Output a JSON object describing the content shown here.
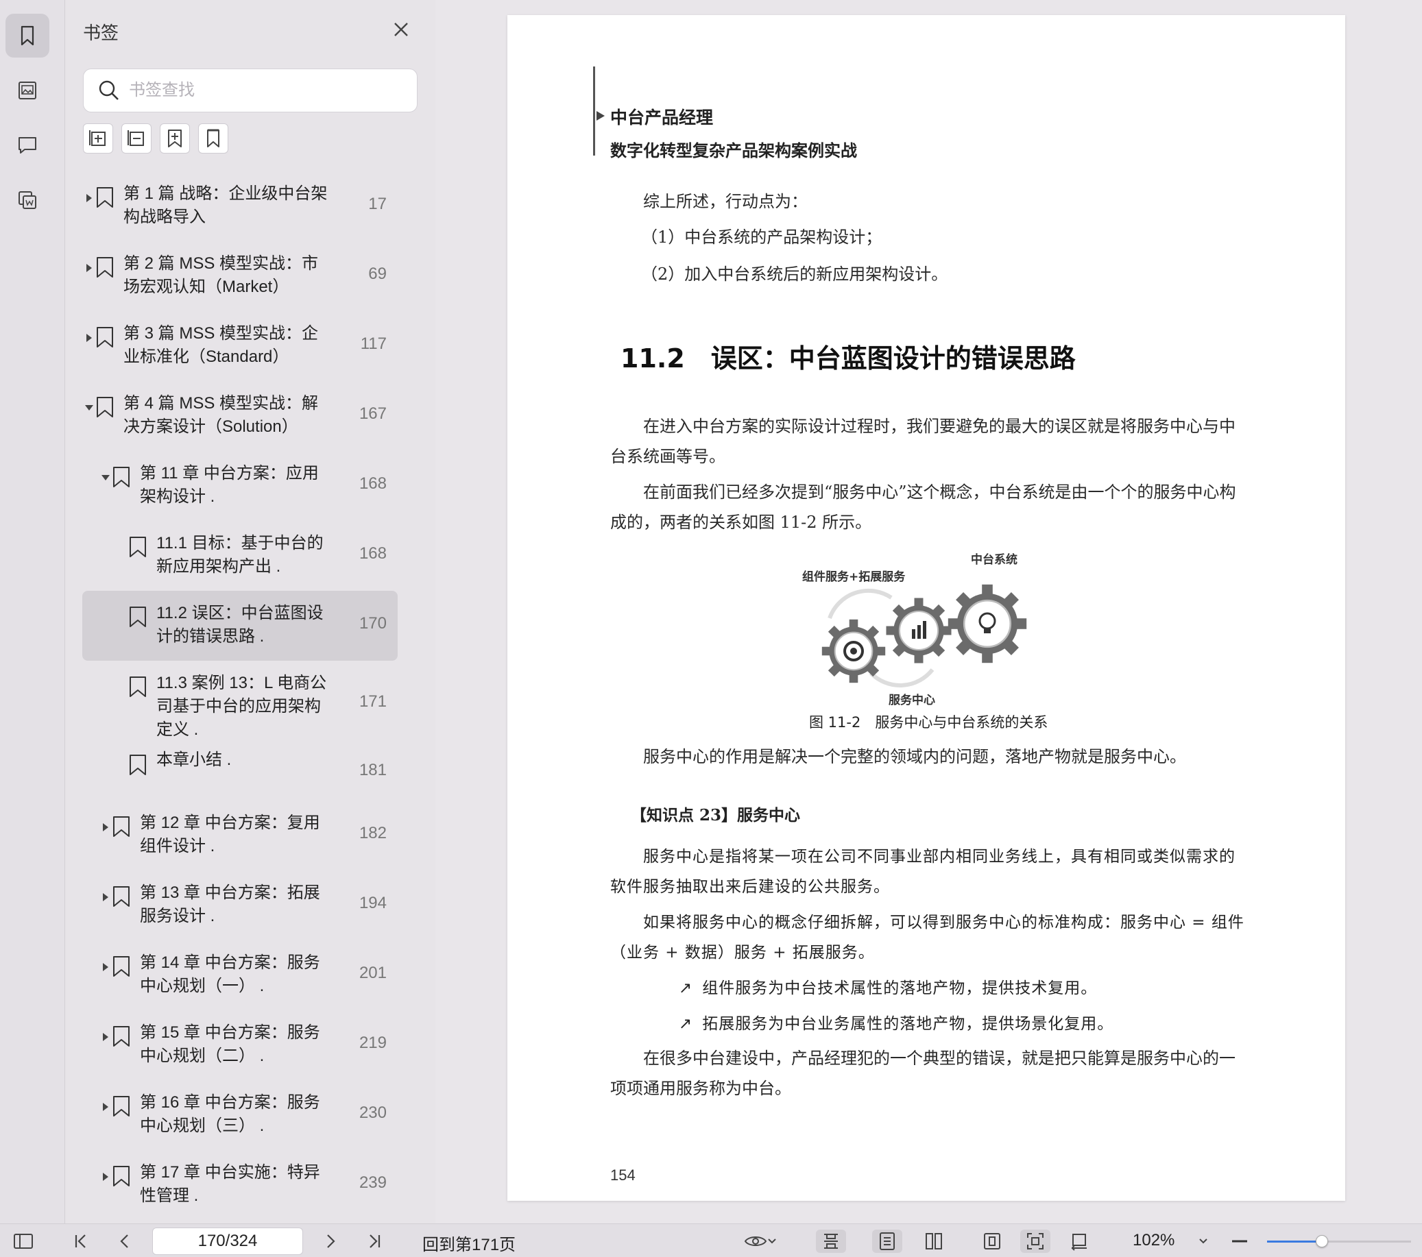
{
  "panel": {
    "title": "书签",
    "search_placeholder": "书签查找",
    "tools": [
      "expand-all-icon",
      "collapse-all-icon",
      "add-bookmark-icon",
      "bookmark-icon"
    ]
  },
  "bookmarks": [
    {
      "level": 0,
      "arrow": "right",
      "label": "第 1 篇 战略：企业级中台架构战略导入",
      "page": "17"
    },
    {
      "level": 0,
      "arrow": "right",
      "label": "第 2 篇 MSS 模型实战：市场宏观认知（Market）",
      "page": "69"
    },
    {
      "level": 0,
      "arrow": "right",
      "label": "第 3 篇 MSS 模型实战：企业标准化（Standard）",
      "page": "117"
    },
    {
      "level": 0,
      "arrow": "down",
      "label": "第 4 篇 MSS 模型实战：解决方案设计（Solution）",
      "page": "167"
    },
    {
      "level": 1,
      "arrow": "down",
      "label": "第 11 章 中台方案：应用架构设计 .",
      "page": "168"
    },
    {
      "level": 2,
      "arrow": "none",
      "label": "11.1 目标：基于中台的新应用架构产出 .",
      "page": "168"
    },
    {
      "level": 2,
      "arrow": "none",
      "label": "11.2 误区：中台蓝图设计的错误思路 .",
      "page": "170",
      "selected": true
    },
    {
      "level": 2,
      "arrow": "none",
      "label": "11.3 案例 13：L 电商公司基于中台的应用架构定义 .",
      "page": "171",
      "tall": true
    },
    {
      "level": 2,
      "arrow": "none",
      "label": "本章小结 .",
      "page": "181",
      "short": true
    },
    {
      "level": 1,
      "arrow": "right",
      "label": "第 12 章 中台方案：复用组件设计 .",
      "page": "182"
    },
    {
      "level": 1,
      "arrow": "right",
      "label": "第 13 章 中台方案：拓展服务设计 .",
      "page": "194"
    },
    {
      "level": 1,
      "arrow": "right",
      "label": "第 14 章 中台方案：服务中心规划（一） .",
      "page": "201"
    },
    {
      "level": 1,
      "arrow": "right",
      "label": "第 15 章 中台方案：服务中心规划（二） .",
      "page": "219"
    },
    {
      "level": 1,
      "arrow": "right",
      "label": "第 16 章 中台方案：服务中心规划（三） .",
      "page": "230"
    },
    {
      "level": 1,
      "arrow": "right",
      "label": "第 17 章 中台实施：特异性管理 .",
      "page": "239"
    }
  ],
  "page": {
    "header_title": "中台产品经理",
    "header_subtitle": "数字化转型复杂产品架构案例实战",
    "intro": "综上所述，行动点为：",
    "action1": "（1）中台系统的产品架构设计；",
    "action2": "（2）加入中台系统后的新应用架构设计。",
    "section_title": "11.2　误区：中台蓝图设计的错误思路",
    "para1": "在进入中台方案的实际设计过程时，我们要避免的最大的误区就是将服务中心与中台系统画等号。",
    "para2": "在前面我们已经多次提到“服务中心”这个概念，中台系统是由一个个的服务中心构成的，两者的关系如图 11-2 所示。",
    "figure_label_top_right": "中台系统",
    "figure_label_top_left": "组件服务+拓展服务",
    "figure_label_bottom": "服务中心",
    "figure_caption": "图 11-2　服务中心与中台系统的关系",
    "para3": "服务中心的作用是解决一个完整的领域内的问题，落地产物就是服务中心。",
    "kp_title": "【知识点 23】服务中心",
    "kp1": "服务中心是指将某一项在公司不同事业部内相同业务线上，具有相同或类似需求的软件服务抽取出来后建设的公共服务。",
    "kp2": "如果将服务中心的概念仔细拆解，可以得到服务中心的标准构成：服务中心 = 组件（业务 + 数据）服务 + 拓展服务。",
    "bullet1": "组件服务为中台技术属性的落地产物，提供技术复用。",
    "bullet2": "拓展服务为中台业务属性的落地产物，提供场景化复用。",
    "para4": "在很多中台建设中，产品经理犯的一个典型的错误，就是把只能算是服务中心的一项项通用服务称为中台。",
    "page_number": "154"
  },
  "statusbar": {
    "page_field": "170/324",
    "goto_label": "回到第171页",
    "zoom": "102%",
    "zoom_slider_fraction": 0.38
  }
}
